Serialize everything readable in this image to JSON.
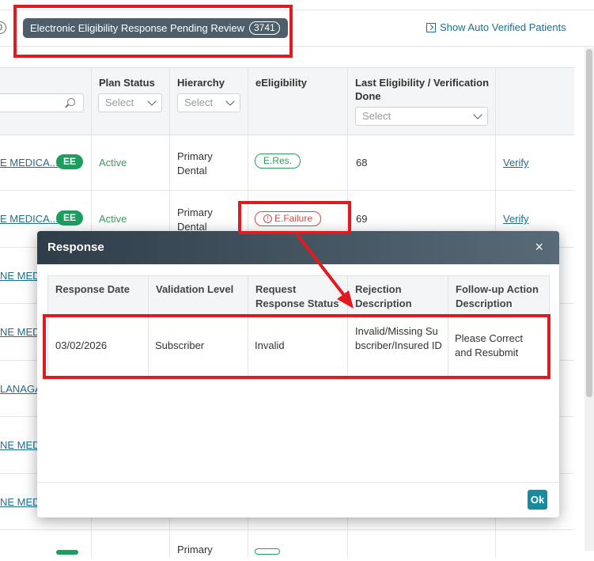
{
  "topbar": {
    "left_count": "0",
    "tab_label": "Electronic Eligibility Response Pending Review",
    "tab_count": "3741",
    "auto_link": "Show Auto Verified Patients"
  },
  "grid": {
    "headers": {
      "plan_status": "Plan Status",
      "hierarchy": "Hierarchy",
      "eligibility": "eEligibility",
      "last_verification": "Last Eligibility / Verification Done"
    },
    "filter_placeholder": "Select",
    "rows": [
      {
        "name": "E MEDICA...",
        "badge": "EE",
        "status": "Active",
        "hierarchy": "Primary Dental",
        "elig": "E.Res.",
        "last": "68",
        "action": "Verify"
      },
      {
        "name": "E MEDICA...",
        "badge": "EE",
        "status": "Active",
        "hierarchy": "Primary Dental",
        "elig": "E.Failure",
        "last": "69",
        "action": "Verify"
      }
    ],
    "partial_names": [
      "NE MEDI",
      "NE MEDI",
      "LANAGA",
      "NE MEDI",
      "NE MEDIC"
    ],
    "bottom_hierarchy": "Primary"
  },
  "modal": {
    "title": "Response",
    "close": "×",
    "columns": [
      "Response Date",
      "Validation Level",
      "Request Response Status",
      "Rejection Description",
      "Follow-up Action Description"
    ],
    "row": [
      "03/02/2026",
      "Subscriber",
      "Invalid",
      "Invalid/Missing Subscriber/Insured ID",
      "Please Correct and Resubmit"
    ],
    "ok": "Ok"
  },
  "colors": {
    "annotation": "#e01a1f",
    "header": "#3f4f5c",
    "link": "#1f6f8b",
    "ok": "#1a8aa0"
  }
}
